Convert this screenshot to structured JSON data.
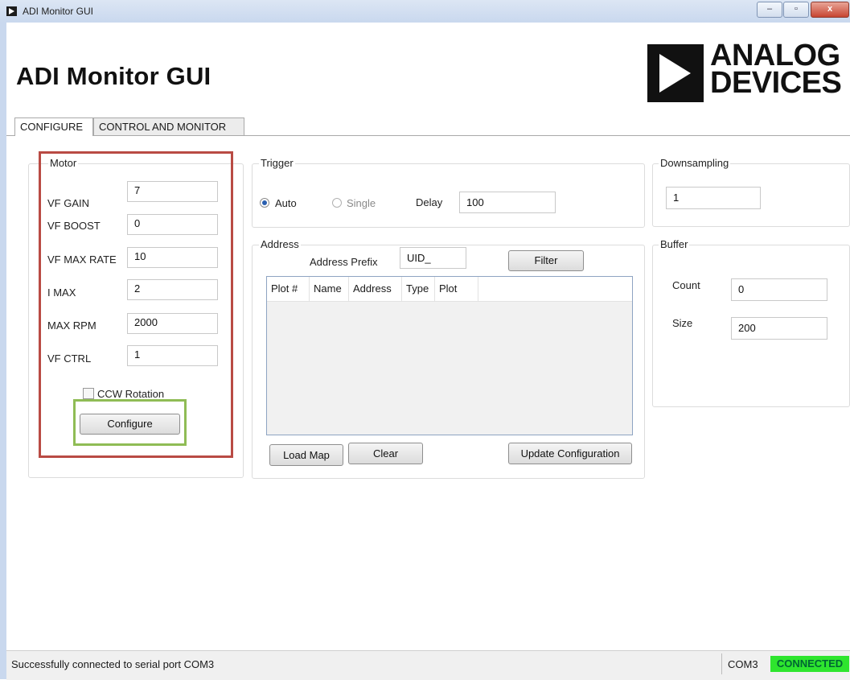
{
  "window": {
    "title": "ADI Monitor GUI",
    "controls": {
      "minimize": "–",
      "maximize": "▫",
      "close": "x"
    }
  },
  "header": {
    "app_title": "ADI Monitor GUI",
    "logo": {
      "line1": "ANALOG",
      "line2": "DEVICES"
    }
  },
  "tabs": [
    {
      "label": "CONFIGURE",
      "active": true
    },
    {
      "label": "CONTROL AND MONITOR",
      "active": false
    }
  ],
  "motor": {
    "legend": "Motor",
    "fields": [
      {
        "label": "VF GAIN",
        "value": "7"
      },
      {
        "label": "VF BOOST",
        "value": "0"
      },
      {
        "label": "VF MAX RATE",
        "value": "10"
      },
      {
        "label": "I MAX",
        "value": "2"
      },
      {
        "label": "MAX RPM",
        "value": "2000"
      },
      {
        "label": "VF CTRL",
        "value": "1"
      }
    ],
    "ccw_label": "CCW Rotation",
    "ccw_checked": false,
    "configure_button": "Configure"
  },
  "trigger": {
    "legend": "Trigger",
    "auto_label": "Auto",
    "single_label": "Single",
    "selected": "Auto",
    "delay_label": "Delay",
    "delay_value": "100"
  },
  "address": {
    "legend": "Address",
    "prefix_label": "Address Prefix",
    "prefix_value": "UID_",
    "filter_button": "Filter",
    "columns": [
      "Plot #",
      "Name",
      "Address",
      "Type",
      "Plot"
    ],
    "rows": [],
    "load_map_button": "Load Map",
    "clear_button": "Clear",
    "update_button": "Update Configuration"
  },
  "downsampling": {
    "legend": "Downsampling",
    "value": "1"
  },
  "buffer": {
    "legend": "Buffer",
    "count_label": "Count",
    "count_value": "0",
    "size_label": "Size",
    "size_value": "200"
  },
  "status": {
    "message": "Successfully connected to serial port COM3",
    "port": "COM3",
    "connection": "CONNECTED",
    "connection_color": "#2ee52e"
  },
  "annotations": {
    "motor_highlight_color": "#b94b44",
    "configure_highlight_color": "#8fbc55"
  }
}
